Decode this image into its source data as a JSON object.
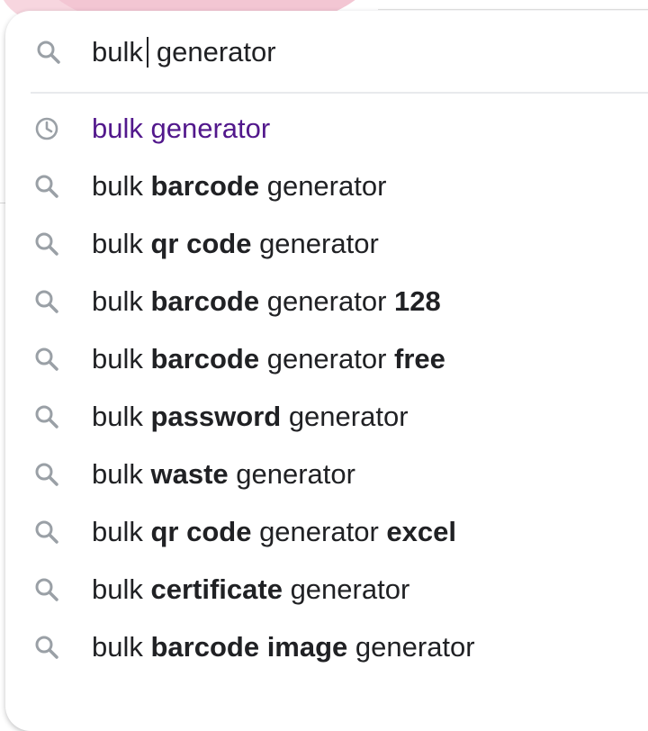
{
  "search": {
    "query_before_caret": "bulk",
    "query_after_caret": "generator",
    "icon": "search-icon"
  },
  "colors": {
    "text": "#202124",
    "history_text": "#52188c",
    "icon": "#9aa0a6",
    "divider": "#e8eaed"
  },
  "suggestions": [
    {
      "type": "history",
      "icon": "history-icon",
      "parts": [
        {
          "text": "bulk generator",
          "bold": false
        }
      ]
    },
    {
      "type": "search",
      "icon": "search-icon",
      "parts": [
        {
          "text": "bulk ",
          "bold": false
        },
        {
          "text": "barcode",
          "bold": true
        },
        {
          "text": " generator",
          "bold": false
        }
      ]
    },
    {
      "type": "search",
      "icon": "search-icon",
      "parts": [
        {
          "text": "bulk ",
          "bold": false
        },
        {
          "text": "qr code",
          "bold": true
        },
        {
          "text": " generator",
          "bold": false
        }
      ]
    },
    {
      "type": "search",
      "icon": "search-icon",
      "parts": [
        {
          "text": "bulk ",
          "bold": false
        },
        {
          "text": "barcode",
          "bold": true
        },
        {
          "text": " generator ",
          "bold": false
        },
        {
          "text": "128",
          "bold": true
        }
      ]
    },
    {
      "type": "search",
      "icon": "search-icon",
      "parts": [
        {
          "text": "bulk ",
          "bold": false
        },
        {
          "text": "barcode",
          "bold": true
        },
        {
          "text": " generator ",
          "bold": false
        },
        {
          "text": "free",
          "bold": true
        }
      ]
    },
    {
      "type": "search",
      "icon": "search-icon",
      "parts": [
        {
          "text": "bulk ",
          "bold": false
        },
        {
          "text": "password",
          "bold": true
        },
        {
          "text": " generator",
          "bold": false
        }
      ]
    },
    {
      "type": "search",
      "icon": "search-icon",
      "parts": [
        {
          "text": "bulk ",
          "bold": false
        },
        {
          "text": "waste",
          "bold": true
        },
        {
          "text": " generator",
          "bold": false
        }
      ]
    },
    {
      "type": "search",
      "icon": "search-icon",
      "parts": [
        {
          "text": "bulk ",
          "bold": false
        },
        {
          "text": "qr code",
          "bold": true
        },
        {
          "text": " generator ",
          "bold": false
        },
        {
          "text": "excel",
          "bold": true
        }
      ]
    },
    {
      "type": "search",
      "icon": "search-icon",
      "parts": [
        {
          "text": "bulk ",
          "bold": false
        },
        {
          "text": "certificate",
          "bold": true
        },
        {
          "text": " generator",
          "bold": false
        }
      ]
    },
    {
      "type": "search",
      "icon": "search-icon",
      "parts": [
        {
          "text": "bulk ",
          "bold": false
        },
        {
          "text": "barcode image",
          "bold": true
        },
        {
          "text": " generator",
          "bold": false
        }
      ]
    }
  ]
}
